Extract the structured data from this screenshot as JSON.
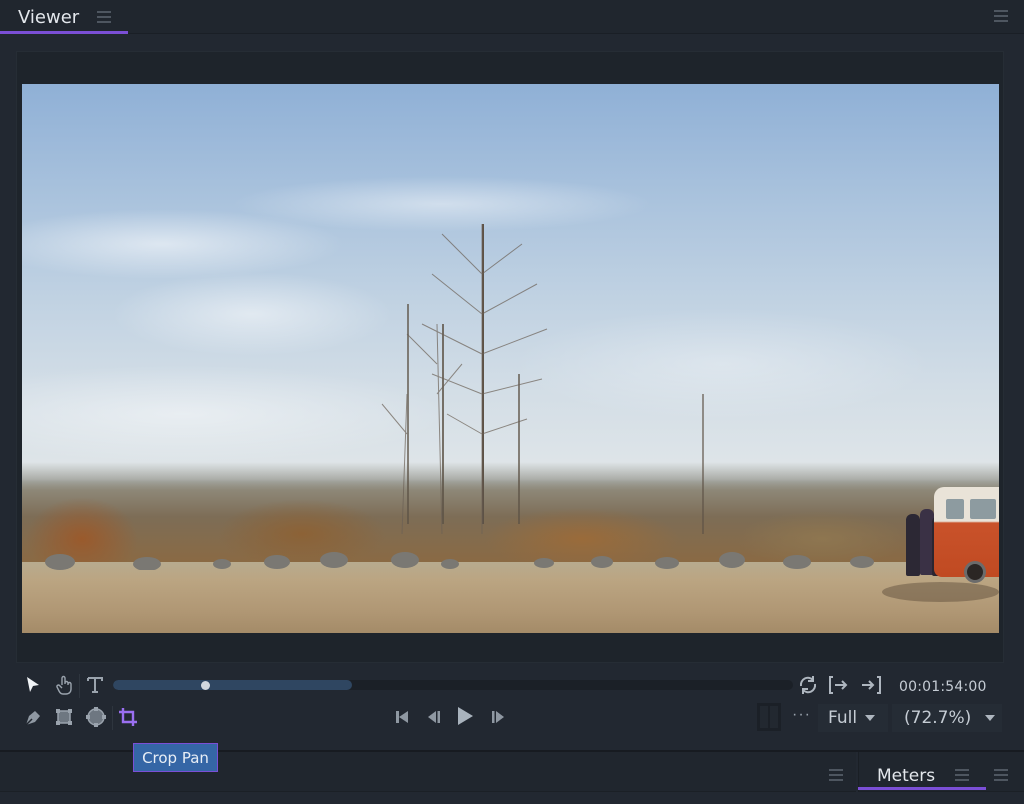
{
  "viewer_panel": {
    "tab_label": "Viewer",
    "tab_menu_icon": "hamburger-menu-icon",
    "panel_menu_icon": "hamburger-menu-icon"
  },
  "video": {
    "description": "Wide shot of a winter field with bare trees under a pale blue sky; people pushing an orange-and-white van at right"
  },
  "tools_row1": [
    {
      "name": "select-tool",
      "icon": "arrow-pointer-icon",
      "active": true
    },
    {
      "name": "hand-tool",
      "icon": "hand-icon",
      "active": false
    },
    {
      "name": "text-tool",
      "icon": "text-t-icon",
      "active": false
    }
  ],
  "tools_row2": [
    {
      "name": "pen-tool",
      "icon": "pen-nib-icon",
      "active": false
    },
    {
      "name": "transform-tool",
      "icon": "transform-square-icon",
      "active": false
    },
    {
      "name": "mask-tool",
      "icon": "circle-handles-icon",
      "active": false
    },
    {
      "name": "crop-pan-tool",
      "icon": "crop-icon",
      "active": true
    }
  ],
  "scrubber": {
    "playhead_fraction": 0.135,
    "buffered_fraction": 0.351
  },
  "transport": {
    "loop_icon": "loop-icon",
    "mark_in_icon": "mark-in-icon",
    "mark_out_icon": "mark-out-icon",
    "timecode": "00:01:54:00",
    "buttons": [
      "go-to-start",
      "step-back",
      "play",
      "step-forward"
    ]
  },
  "view_options": {
    "more_label": "···",
    "quality_selected": "Full",
    "zoom_selected": "(72.7%)"
  },
  "tooltip": {
    "text": "Crop Pan"
  },
  "bottom_panels": {
    "meters_tab_label": "Meters"
  },
  "colors": {
    "accent": "#7b4fd6",
    "tooltip_bg": "#3566a6",
    "panel_bg": "#222831",
    "active_tool": "#9a6ff0"
  }
}
